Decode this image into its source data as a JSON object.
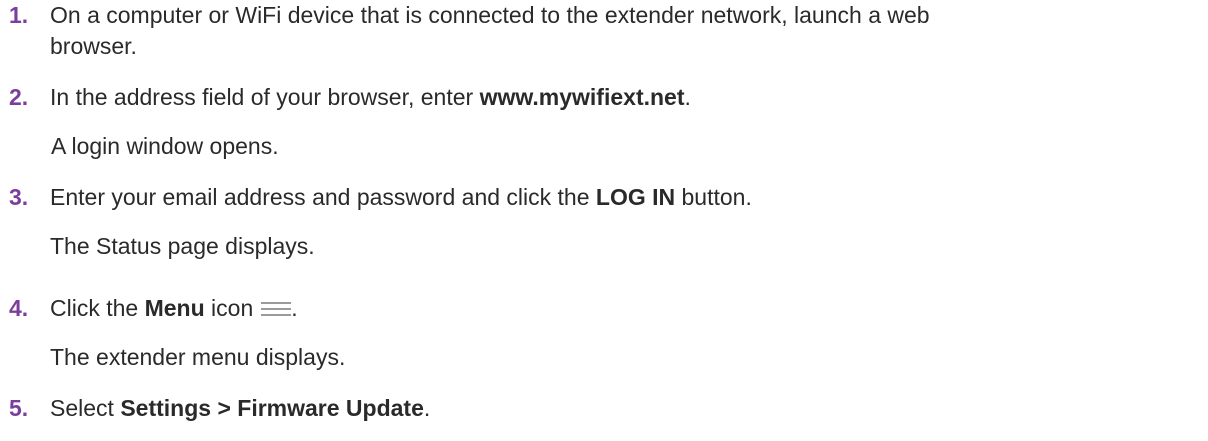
{
  "steps": [
    {
      "number": "1.",
      "line1": "On a computer or WiFi device that is connected to the extender network, launch a web",
      "line2": "browser."
    },
    {
      "number": "2.",
      "prefix": "In the address field of your browser, enter ",
      "bold": "www.mywifiext.net",
      "suffix": ".",
      "note": "A login window opens."
    },
    {
      "number": "3.",
      "prefix": "Enter your email address and password and click the ",
      "bold": "LOG IN",
      "suffix": " button.",
      "note": "The Status page displays."
    },
    {
      "number": "4.",
      "prefix": "Click the ",
      "bold": "Menu",
      "middle": " icon",
      "icon": "hamburger-menu-icon",
      "suffix": ".",
      "note": "The extender menu displays."
    },
    {
      "number": "5.",
      "prefix": "Select ",
      "bold": "Settings > Firmware Update",
      "suffix": "."
    }
  ]
}
